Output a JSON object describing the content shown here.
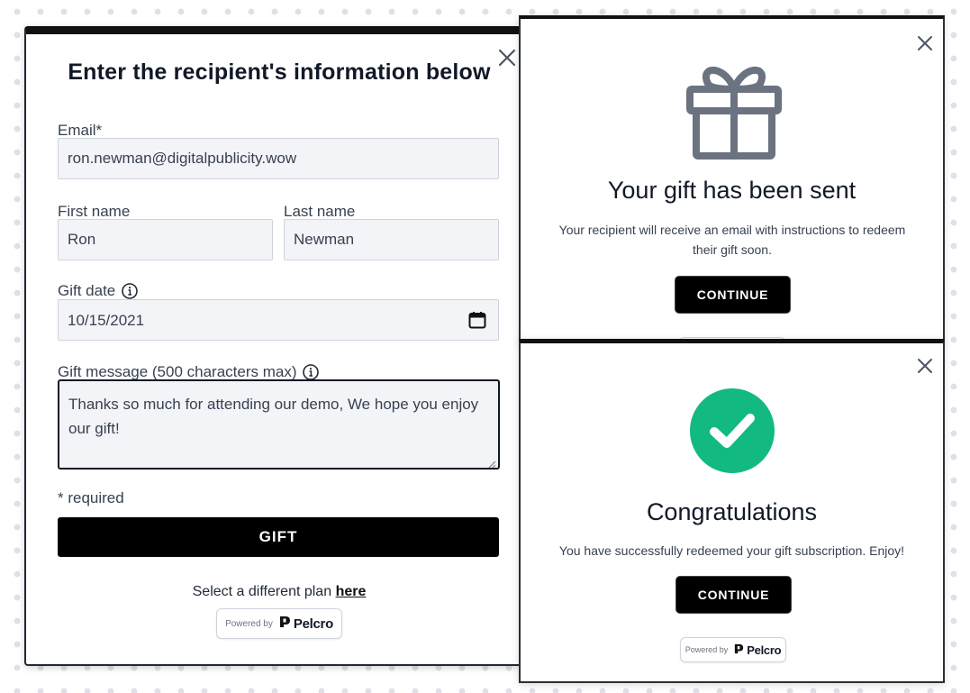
{
  "recipient_form": {
    "title": "Enter the recipient's information below",
    "email_label": "Email*",
    "email_value": "ron.newman@digitalpublicity.wow",
    "first_name_label": "First name",
    "first_name_value": "Ron",
    "last_name_label": "Last name",
    "last_name_value": "Newman",
    "gift_date_label": "Gift date",
    "gift_date_value": "10/15/2021",
    "gift_message_label": "Gift message (500 characters max)",
    "gift_message_value": "Thanks so much for attending our demo, We hope you enjoy our gift!",
    "required_note": "* required",
    "gift_button": "GIFT",
    "plan_text": "Select a different plan",
    "plan_link": "here",
    "powered_by": "Powered by",
    "brand": "Pelcro"
  },
  "gift_sent": {
    "title": "Your gift has been sent",
    "description": "Your recipient will receive an email with instructions to redeem their gift soon.",
    "continue_button": "CONTINUE"
  },
  "redeemed": {
    "title": "Congratulations",
    "description": "You have successfully redeemed your gift subscription. Enjoy!",
    "continue_button": "CONTINUE",
    "powered_by": "Powered by",
    "brand": "Pelcro"
  },
  "icons": {
    "close": "close-icon",
    "info": "info-icon",
    "calendar": "calendar-icon",
    "gift": "gift-icon",
    "success": "check-circle-icon",
    "brand_logo": "pelcro-logo-icon"
  },
  "colors": {
    "primary_button": "#000000",
    "input_background": "#f3f4f7",
    "success_green": "#12b981",
    "gift_icon": "#6b7280"
  }
}
